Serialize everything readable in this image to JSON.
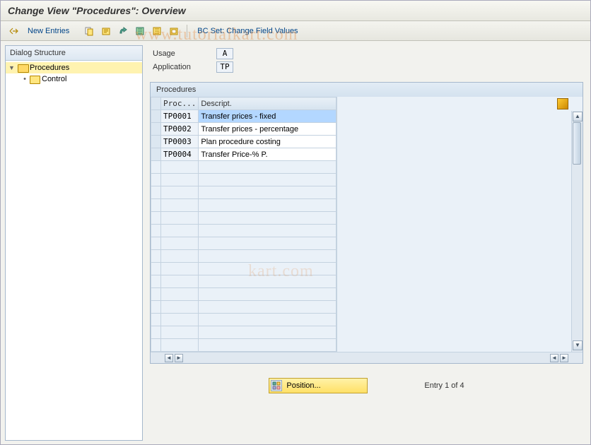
{
  "title": "Change View \"Procedures\": Overview",
  "toolbar": {
    "new_entries": "New Entries",
    "bc_set": "BC Set: Change Field Values"
  },
  "tree": {
    "header": "Dialog Structure",
    "items": [
      {
        "label": "Procedures",
        "selected": true,
        "level": 0,
        "open": true
      },
      {
        "label": "Control",
        "selected": false,
        "level": 1,
        "open": false
      }
    ]
  },
  "form": {
    "usage_label": "Usage",
    "usage_value": "A",
    "application_label": "Application",
    "application_value": "TP"
  },
  "table": {
    "title": "Procedures",
    "col_proc": "Proc...",
    "col_desc": "Descript.",
    "rows": [
      {
        "proc": "TP0001",
        "desc": "Transfer prices - fixed",
        "selected": true
      },
      {
        "proc": "TP0002",
        "desc": "Transfer prices - percentage",
        "selected": false
      },
      {
        "proc": "TP0003",
        "desc": "Plan procedure costing",
        "selected": false
      },
      {
        "proc": "TP0004",
        "desc": "Transfer Price-% P.",
        "selected": false
      }
    ],
    "empty_rows": 15
  },
  "footer": {
    "position": "Position...",
    "entry": "Entry 1 of 4"
  },
  "watermark": "www.tutorialkart.com"
}
